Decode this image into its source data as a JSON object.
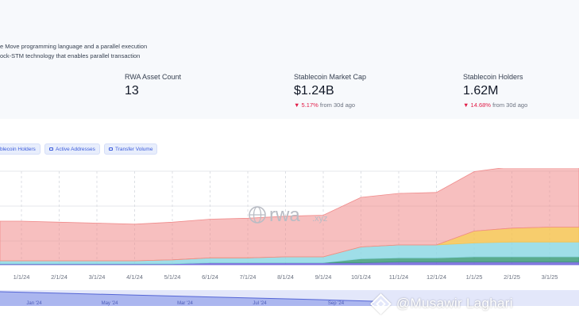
{
  "description": {
    "line1": "e Move programming language and a parallel execution",
    "line2": "ock-STM technology that enables parallel transaction"
  },
  "metrics": [
    {
      "label": "RWA Asset Count",
      "value": "13"
    },
    {
      "label": "Stablecoin Market Cap",
      "value": "$1.24B",
      "change": "5.17%",
      "change_suffix": "from 30d ago",
      "trend": "down"
    },
    {
      "label": "Stablecoin Holders",
      "value": "1.62M",
      "change": "14.68%",
      "change_suffix": "from 30d ago",
      "trend": "down"
    }
  ],
  "chips": [
    {
      "label": "blecoin Holders"
    },
    {
      "label": "Active Addresses"
    },
    {
      "label": "Transfer Volume"
    }
  ],
  "watermark_rwa": {
    "main": "rwa",
    "suffix": ".xyz"
  },
  "overlay_watermark": "@Musawir Laghari",
  "colors": {
    "negative": "#e11d48",
    "chip_text": "#3b5bdb",
    "brush": "#6b7ee0"
  },
  "icons": {
    "down_arrow": "▼",
    "lock": "lock-icon",
    "globe": "globe-icon"
  },
  "chart_data": {
    "type": "area",
    "x_ticks": [
      "1/1/24",
      "2/1/24",
      "3/1/24",
      "4/1/24",
      "5/1/24",
      "6/1/24",
      "7/1/24",
      "8/1/24",
      "9/1/24",
      "10/1/24",
      "11/1/24",
      "12/1/24",
      "1/1/25",
      "2/1/25",
      "3/1/25"
    ],
    "brush_ticks": [
      "Jan '24",
      "May '24",
      "Mar '24",
      "Jul '24",
      "Sep '24"
    ],
    "grid": true,
    "series": [
      {
        "color": "#f08a8a",
        "values": [
          40,
          39,
          38,
          37,
          38,
          39,
          40,
          41,
          42,
          50,
          52,
          53,
          60,
          62,
          63
        ]
      },
      {
        "color": "#f6c453",
        "values": [
          0,
          0,
          0,
          0,
          0,
          0,
          0,
          0,
          0,
          0,
          0,
          0,
          12,
          14,
          15
        ]
      },
      {
        "color": "#8ed8e4",
        "values": [
          3,
          3,
          3,
          3,
          4,
          5,
          5,
          6,
          6,
          12,
          13,
          13,
          14,
          15,
          15
        ]
      },
      {
        "color": "#3d9c7a",
        "values": [
          0,
          0,
          0,
          0,
          0,
          0,
          0,
          0,
          0,
          4,
          4,
          4,
          5,
          5,
          5
        ]
      },
      {
        "color": "#6c63d8",
        "values": [
          1,
          1,
          1,
          1,
          1,
          2,
          2,
          2,
          2,
          2,
          3,
          3,
          3,
          3,
          3
        ]
      }
    ]
  }
}
